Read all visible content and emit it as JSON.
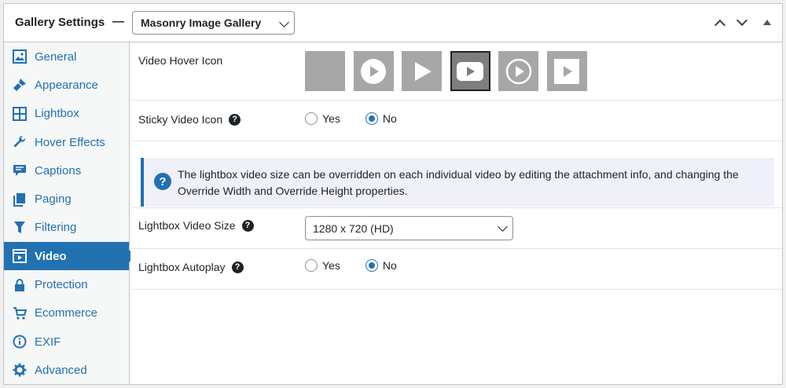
{
  "header": {
    "title": "Gallery Settings",
    "separator": "—",
    "template_select": "Masonry Image Gallery"
  },
  "sidebar": {
    "items": [
      {
        "label": "General",
        "icon": "image-icon"
      },
      {
        "label": "Appearance",
        "icon": "brush-icon"
      },
      {
        "label": "Lightbox",
        "icon": "grid-icon"
      },
      {
        "label": "Hover Effects",
        "icon": "wrench-icon"
      },
      {
        "label": "Captions",
        "icon": "comment-icon"
      },
      {
        "label": "Paging",
        "icon": "pages-icon"
      },
      {
        "label": "Filtering",
        "icon": "filter-icon"
      },
      {
        "label": "Video",
        "icon": "video-icon",
        "active": true
      },
      {
        "label": "Protection",
        "icon": "lock-icon"
      },
      {
        "label": "Ecommerce",
        "icon": "cart-icon"
      },
      {
        "label": "EXIF",
        "icon": "info-icon"
      },
      {
        "label": "Advanced",
        "icon": "gear-icon"
      }
    ]
  },
  "settings": {
    "video_hover_icon": {
      "label": "Video Hover Icon",
      "selected_index": 3
    },
    "sticky_video_icon": {
      "label": "Sticky Video Icon",
      "yes": "Yes",
      "no": "No",
      "value": "No"
    },
    "notice": "The lightbox video size can be overridden on each individual video by editing the attachment info, and changing the Override Width and Override Height properties.",
    "lightbox_video_size": {
      "label": "Lightbox Video Size",
      "value": "1280 x 720 (HD)"
    },
    "lightbox_autoplay": {
      "label": "Lightbox Autoplay",
      "yes": "Yes",
      "no": "No",
      "value": "No"
    }
  },
  "colors": {
    "accent": "#2271b1",
    "icon_bg": "#a7a7a7",
    "icon_selected_bg": "#7e7e7e"
  }
}
